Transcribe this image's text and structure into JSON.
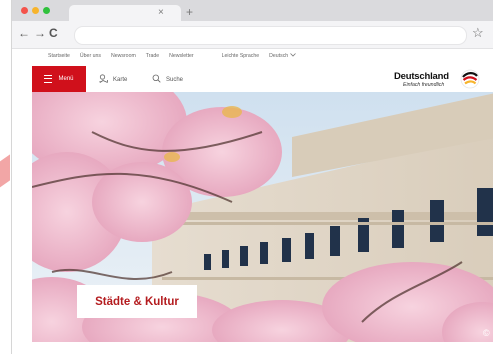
{
  "browser": {
    "tab_close": "×",
    "new_tab": "+",
    "back": "←",
    "forward": "→",
    "reload": "C",
    "bookmark": "☆"
  },
  "site": {
    "utility_nav": [
      "Startseite",
      "Über uns",
      "Newsroom",
      "Trade",
      "Newsletter",
      "Leichte Sprache",
      "Deutsch"
    ],
    "menu_label": "Menü",
    "map_label": "Karte",
    "search_label": "Suche",
    "logo_title": "Deutschland",
    "logo_subtitle": "Einfach freundlich"
  },
  "hero": {
    "title": "Städte & Kultur",
    "copyright": "©"
  },
  "colors": {
    "brand_red": "#d0101b",
    "hero_title_red": "#b41c1f",
    "traffic_red": "#f4534b",
    "traffic_yellow": "#f7b42c",
    "traffic_green": "#2fc13c"
  },
  "icons": [
    "hamburger-icon",
    "map-icon",
    "search-icon",
    "logo-swoosh-icon",
    "chevron-down-icon",
    "star-icon"
  ]
}
